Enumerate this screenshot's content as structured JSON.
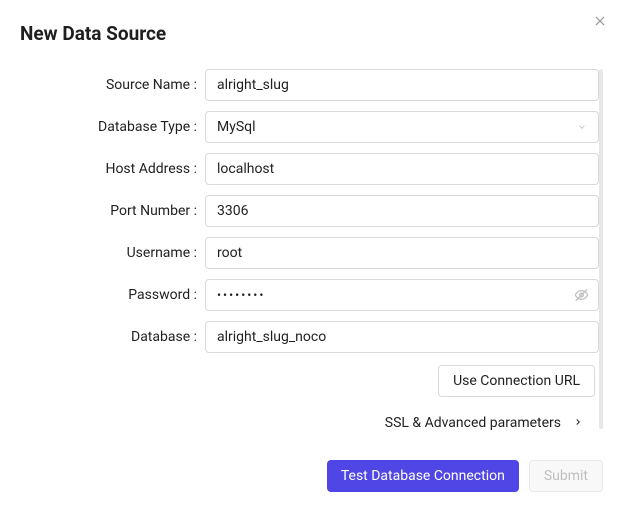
{
  "modal": {
    "title": "New Data Source"
  },
  "form": {
    "labels": {
      "source_name": "Source Name",
      "database_type": "Database Type",
      "host_address": "Host Address",
      "port_number": "Port Number",
      "username": "Username",
      "password": "Password",
      "database": "Database"
    },
    "values": {
      "source_name": "alright_slug",
      "database_type": "MySql",
      "host_address": "localhost",
      "port_number": "3306",
      "username": "root",
      "password": "••••••••",
      "database": "alright_slug_noco"
    }
  },
  "buttons": {
    "use_connection_url": "Use Connection URL",
    "ssl_advanced": "SSL & Advanced parameters",
    "test_connection": "Test Database Connection",
    "submit": "Submit"
  }
}
